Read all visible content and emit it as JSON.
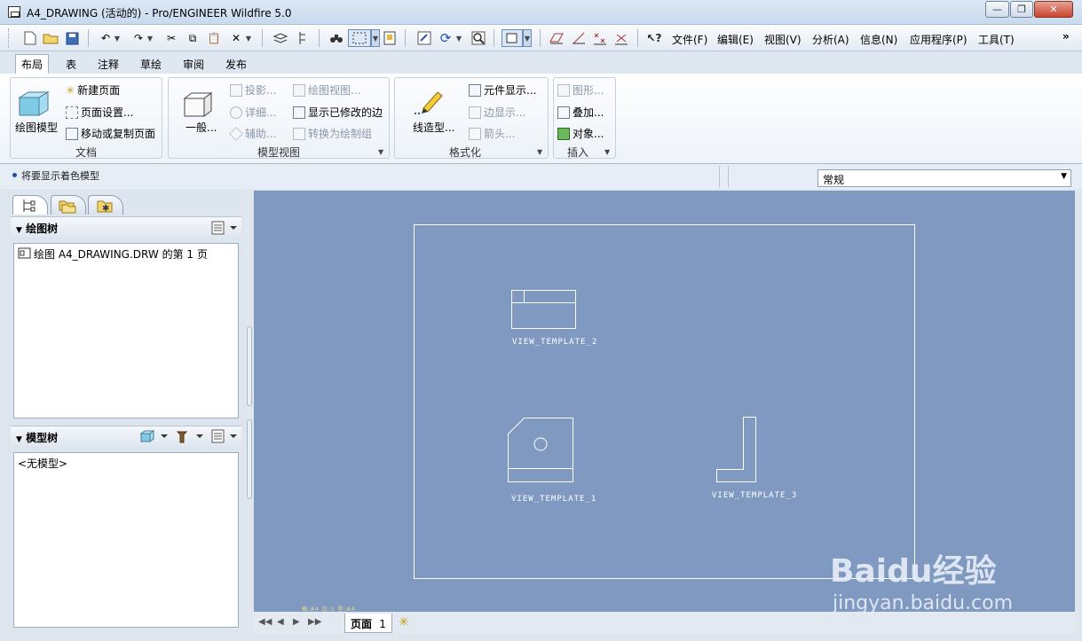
{
  "window": {
    "title": "A4_DRAWING (活动的) - Pro/ENGINEER Wildfire 5.0"
  },
  "menubar": {
    "items": [
      "文件(F)",
      "编辑(E)",
      "视图(V)",
      "分析(A)",
      "信息(N)",
      "应用程序(P)",
      "工具(T)"
    ],
    "overflow": "»"
  },
  "tabs": [
    "布局",
    "表",
    "注释",
    "草绘",
    "审阅",
    "发布"
  ],
  "ribbon": {
    "document": {
      "label": "文档",
      "big_button": "绘图模型",
      "items": [
        "新建页面",
        "页面设置...",
        "移动或复制页面"
      ]
    },
    "model_views": {
      "label": "模型视图",
      "big_button": "一般...",
      "col1": [
        "投影...",
        "详细...",
        "辅助..."
      ],
      "col2": [
        "绘图视图...",
        "显示已修改的边",
        "转换为绘制组"
      ]
    },
    "format": {
      "label": "格式化",
      "big_button": "线造型...",
      "items": [
        "元件显示...",
        "边显示...",
        "箭头..."
      ]
    },
    "insert": {
      "label": "插入",
      "items": [
        "图形...",
        "叠加...",
        "对象..."
      ]
    }
  },
  "status": {
    "message": "将要显示着色模型",
    "filter_value": "常规"
  },
  "drawing_tree": {
    "title": "绘图树",
    "item": "绘图 A4_DRAWING.DRW 的第 1 页"
  },
  "model_tree": {
    "title": "模型树",
    "item": "<无模型>"
  },
  "canvas": {
    "views": [
      "VIEW_TEMPLATE_2",
      "VIEW_TEMPLATE_1",
      "VIEW_TEMPLATE_3"
    ],
    "bottom_info": "格:A4  比:1  型:A4"
  },
  "pagebar": {
    "page_label": "页面",
    "page_number": "1"
  },
  "watermark": {
    "text_top": "Baidu经验",
    "text_bottom": "jingyan.baidu.com"
  },
  "colors": {
    "canvas": "#8099c0",
    "sheet_border": "#ffffff"
  }
}
